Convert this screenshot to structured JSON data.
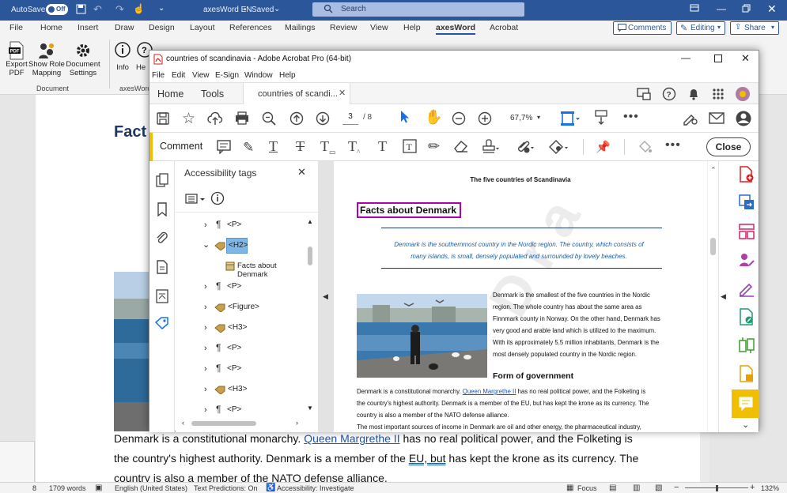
{
  "word": {
    "autosave_label": "AutoSave",
    "autosave_state": "Off",
    "doc_title": "axesWord EN",
    "saved_label": "Saved",
    "search_placeholder": "Search",
    "tabs": [
      "File",
      "Home",
      "Insert",
      "Draw",
      "Design",
      "Layout",
      "References",
      "Mailings",
      "Review",
      "View",
      "Help",
      "axesWord",
      "Acrobat"
    ],
    "comments_btn": "Comments",
    "editing_btn": "Editing",
    "share_btn": "Share",
    "ribbon": {
      "export_pdf": "Export PDF",
      "show_role_mapping": "Show Role Mapping",
      "document_settings": "Document Settings",
      "info": "Info",
      "he_partial": "He",
      "group_document": "Document",
      "group_axesword": "axesWord"
    },
    "doc": {
      "heading_partial": "Fact",
      "para_lines": [
        "Denmark is a constitutional monarchy. ",
        "the country's highest authority. Denmark is a member of the ",
        "country is also a member of the NATO defense alliance."
      ],
      "link_queen": "Queen Margrethe II",
      "line1_rest": " has no real political power, and the Folketing is",
      "eu_text": "EU, but",
      "line2_rest": " has kept the krone as its currency. The"
    },
    "status": {
      "page_partial": "8",
      "words": "1709 words",
      "language": "English (United States)",
      "text_predictions": "Text Predictions: On",
      "accessibility": "Accessibility: Investigate",
      "focus": "Focus",
      "zoom": "132%"
    }
  },
  "acrobat": {
    "title": "countries of scandinavia - Adobe Acrobat Pro (64-bit)",
    "menu": [
      "File",
      "Edit",
      "View",
      "E-Sign",
      "Window",
      "Help"
    ],
    "tabs": {
      "home": "Home",
      "tools": "Tools",
      "doc": "countries of scandi..."
    },
    "page_current": "3",
    "page_total": "/ 8",
    "zoom": "67,7%",
    "comment_label": "Comment",
    "close_btn": "Close",
    "panel": {
      "title": "Accessibility tags",
      "tags": [
        {
          "label": "<P>",
          "kind": "p",
          "expanded": false,
          "selected": false
        },
        {
          "label": "<H2>",
          "kind": "tag",
          "expanded": true,
          "selected": true
        },
        {
          "label": "Facts about Denmark",
          "kind": "content",
          "expanded": false,
          "selected": false
        },
        {
          "label": "<P>",
          "kind": "p",
          "expanded": false,
          "selected": false
        },
        {
          "label": "<Figure>",
          "kind": "tag",
          "expanded": false,
          "selected": false
        },
        {
          "label": "<H3>",
          "kind": "tag",
          "expanded": false,
          "selected": false
        },
        {
          "label": "<P>",
          "kind": "p",
          "expanded": false,
          "selected": false
        },
        {
          "label": "<P>",
          "kind": "p",
          "expanded": false,
          "selected": false
        },
        {
          "label": "<H3>",
          "kind": "tag",
          "expanded": false,
          "selected": false
        },
        {
          "label": "<P>",
          "kind": "p",
          "expanded": false,
          "selected": false
        }
      ]
    },
    "page": {
      "header": "The five countries of Scandinavia",
      "h2": "Facts about Denmark",
      "intro": [
        "Denmark is the southernmost country in the Nordic region. The country, which consists of",
        "many islands, is small, densely populated and surrounded by lovely beaches."
      ],
      "side_para": [
        "Denmark is the smallest of the five countries in the Nordic",
        "region. The whole country has about the same area as",
        "Finnmark county in Norway. On the other hand, Denmark has",
        "very good and arable land which is utilized to the maximum.",
        "With its approximately 5.5 million inhabitants, Denmark is the",
        "most densely populated country in the Nordic region."
      ],
      "h3": "Form of government",
      "body": [
        "Denmark is a constitutional monarchy. ",
        "the country's highest authority. Denmark is a member of the EU, but has kept the krone as its currency. The",
        "country is also a member of the NATO defense alliance.",
        "The most important sources of income in Denmark are oil and other energy, the pharmaceutical industry,"
      ],
      "link": "Queen Margrethe II",
      "body1_rest": " has no real political power, and the Folketing is"
    },
    "colors": {
      "h2_border": "#b000b0",
      "accent_yellow": "#f0c000",
      "selected_tag": "#7fb6e8",
      "link": "#1a55b5"
    }
  }
}
